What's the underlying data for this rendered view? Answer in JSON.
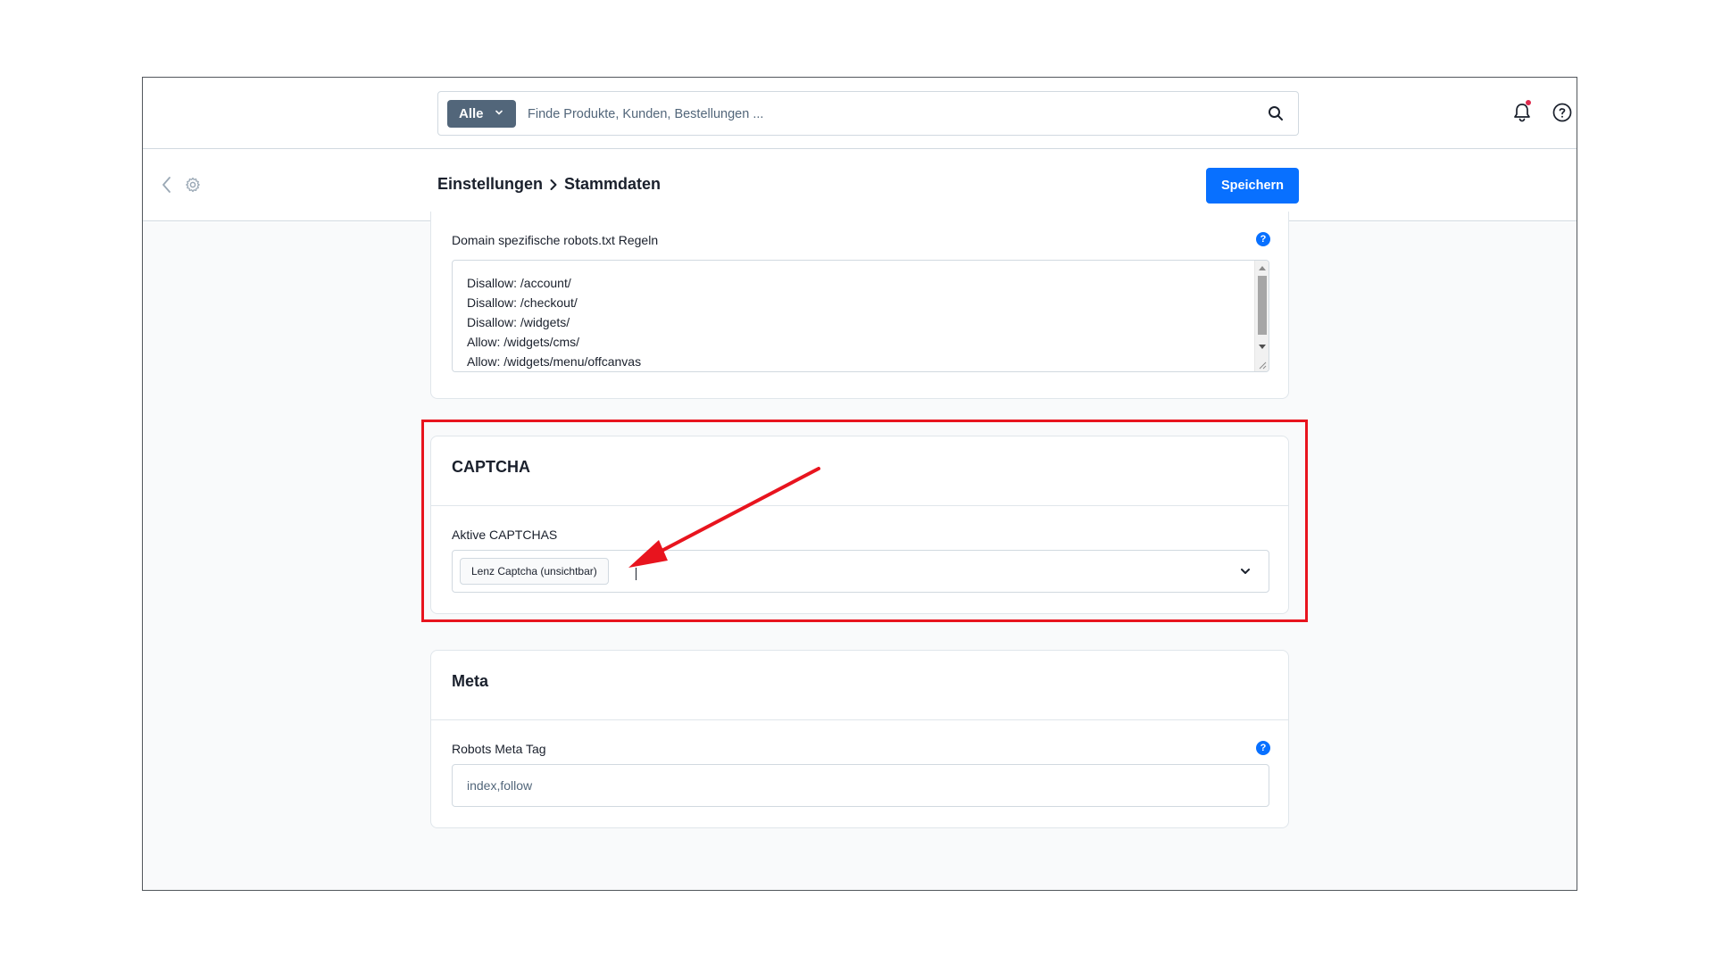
{
  "topbar": {
    "search_scope": "Alle",
    "search_placeholder": "Finde Produkte, Kunden, Bestellungen ..."
  },
  "smartbar": {
    "breadcrumb_parent": "Einstellungen",
    "breadcrumb_current": "Stammdaten",
    "save_label": "Speichern"
  },
  "robots": {
    "label": "Domain spezifische robots.txt Regeln",
    "lines": [
      "Disallow: /account/",
      "Disallow: /checkout/",
      "Disallow: /widgets/",
      "Allow: /widgets/cms/",
      "Allow: /widgets/menu/offcanvas"
    ]
  },
  "captcha": {
    "title": "CAPTCHA",
    "field_label": "Aktive CAPTCHAS",
    "selected": [
      "Lenz Captcha (unsichtbar)"
    ]
  },
  "meta": {
    "title": "Meta",
    "field_label": "Robots Meta Tag",
    "value": "index,follow"
  },
  "colors": {
    "primary": "#0870ff",
    "annotation": "#e8141e",
    "scope_button": "#52667a",
    "notification_dot": "#de294c"
  },
  "icons": [
    "chevron-down-icon",
    "search-icon",
    "bell-icon",
    "help-circle-icon",
    "back-arrow-icon",
    "gear-icon",
    "question-badge-icon",
    "resize-handle-icon"
  ]
}
